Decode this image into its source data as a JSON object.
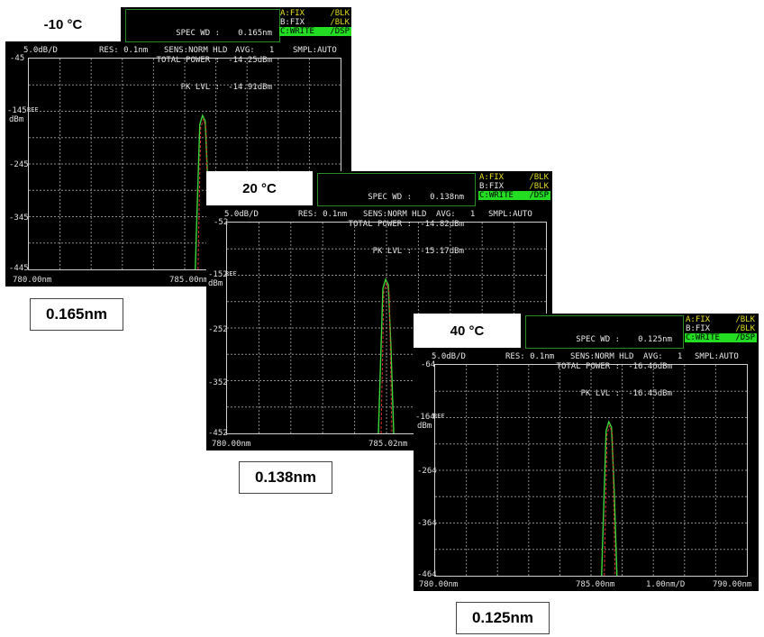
{
  "screens": [
    {
      "temperature": "-10 °C",
      "spec_wd_label": "SPEC WD :",
      "spec_wd_value": "0.165nm",
      "total_power_label": "TOTAL POWER :",
      "total_power_value": "-14.25dBm",
      "pk_lvl_label": "PK LVL :",
      "pk_lvl_value": "-14.91dBm",
      "trace_a": "A:FIX",
      "trace_a_mode": "/BLK",
      "trace_b": "B:FIX",
      "trace_b_mode": "/BLK",
      "trace_c": "C:WRITE",
      "trace_c_mode": "/DSP",
      "scale": "5.0dB/D",
      "res": "RES: 0.1nm",
      "sens": "SENS:NORM HLD",
      "avg": "AVG:   1",
      "smpl": "SMPL:AUTO",
      "y_top": "-45",
      "y_ref": "-145",
      "y_ref_tag": "REF",
      "y_unit": "dBm",
      "y_3": "-245",
      "y_4": "-345",
      "y_bottom": "-445",
      "x_left": "780.00nm",
      "x_center": "785.00nm",
      "x_span": "",
      "x_right": "",
      "caption": "0.165nm"
    },
    {
      "temperature": "20 °C",
      "spec_wd_label": "SPEC WD :",
      "spec_wd_value": "0.138nm",
      "total_power_label": "TOTAL POWER :",
      "total_power_value": "-14.82dBm",
      "pk_lvl_label": "PK LVL :",
      "pk_lvl_value": "-15.17dBm",
      "trace_a": "A:FIX",
      "trace_a_mode": "/BLK",
      "trace_b": "B:FIX",
      "trace_b_mode": "/BLK",
      "trace_c": "C:WRITE",
      "trace_c_mode": "/DSP",
      "scale": "5.0dB/D",
      "res": "RES: 0.1nm",
      "sens": "SENS:NORM HLD",
      "avg": "AVG:   1",
      "smpl": "SMPL:AUTO",
      "y_top": "-52",
      "y_ref": "-152",
      "y_ref_tag": "REF",
      "y_unit": "dBm",
      "y_3": "-252",
      "y_4": "-352",
      "y_bottom": "-452",
      "x_left": "780.00nm",
      "x_center": "785.02nm",
      "x_span": "",
      "x_right": "",
      "caption": "0.138nm"
    },
    {
      "temperature": "40 °C",
      "spec_wd_label": "SPEC WD :",
      "spec_wd_value": "0.125nm",
      "total_power_label": "TOTAL POWER :",
      "total_power_value": "-16.46dBm",
      "pk_lvl_label": "PK LVL :",
      "pk_lvl_value": "-16.45dBm",
      "trace_a": "A:FIX",
      "trace_a_mode": "/BLK",
      "trace_b": "B:FIX",
      "trace_b_mode": "/BLK",
      "trace_c": "C:WRITE",
      "trace_c_mode": "/DSP",
      "scale": "5.0dB/D",
      "res": "RES: 0.1nm",
      "sens": "SENS:NORM HLD",
      "avg": "AVG:   1",
      "smpl": "SMPL:AUTO",
      "y_top": "-64",
      "y_ref": "-164",
      "y_ref_tag": "REF",
      "y_unit": "dBm",
      "y_3": "-264",
      "y_4": "-364",
      "y_bottom": "-464",
      "x_left": "780.00nm",
      "x_center": "785.00nm",
      "x_span": "1.00nm/D",
      "x_right": "790.00nm",
      "caption": "0.125nm"
    }
  ],
  "colors": {
    "trace_green": "#3ad83a",
    "trace_red": "#e03030",
    "grid": "#8a8a8a",
    "active_trace_bg": "#22dd22"
  }
}
